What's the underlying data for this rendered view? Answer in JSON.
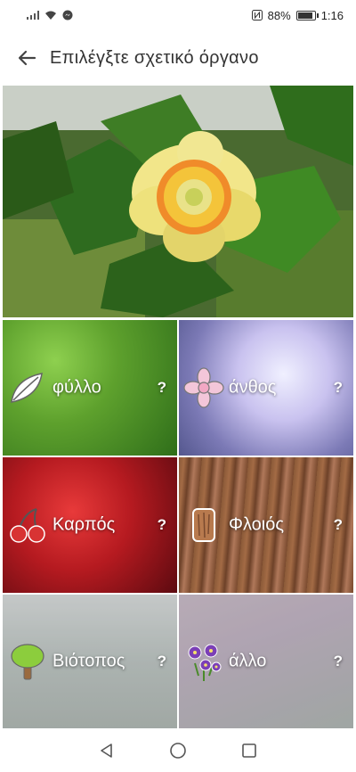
{
  "status_bar": {
    "battery_percent": "88%",
    "time": "1:16"
  },
  "app_bar": {
    "title": "Επιλέγξτε σχετικό όργανο"
  },
  "tiles": [
    {
      "label": "φύλλο",
      "help": "?"
    },
    {
      "label": "άνθος",
      "help": "?"
    },
    {
      "label": "Καρπός",
      "help": "?"
    },
    {
      "label": "Φλοιός",
      "help": "?"
    },
    {
      "label": "Βιότοπος",
      "help": "?"
    },
    {
      "label": "άλλο",
      "help": "?"
    }
  ]
}
